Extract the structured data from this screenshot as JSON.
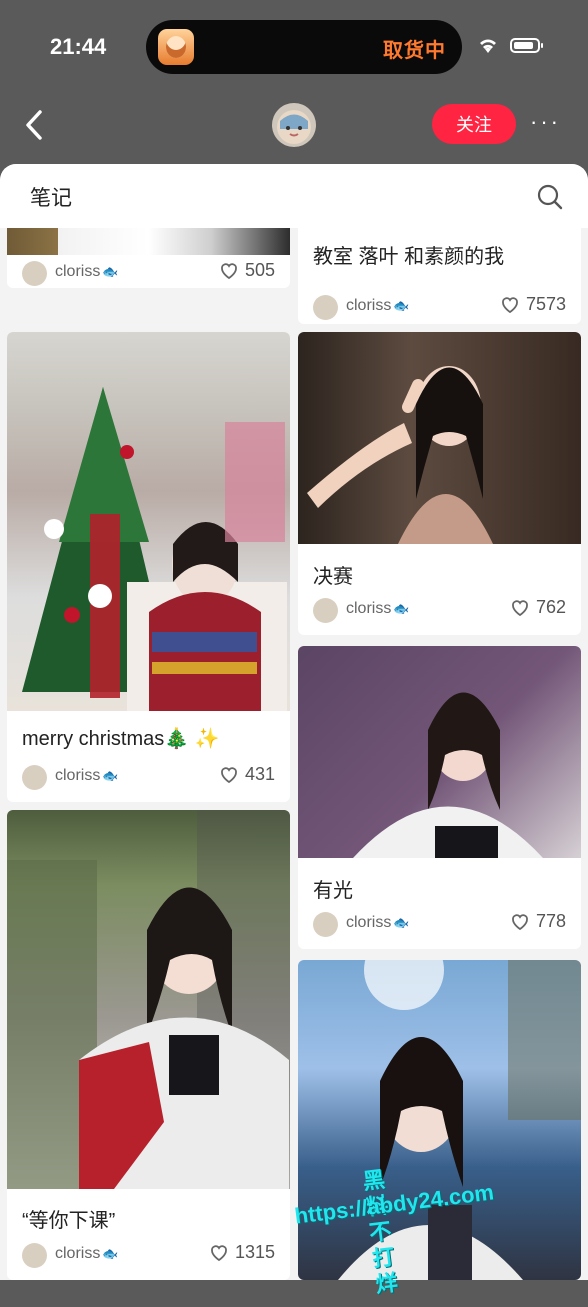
{
  "status_bar": {
    "time": "21:44",
    "live_activity_text": "取货中"
  },
  "header": {
    "follow_label": "关注",
    "more_label": "···"
  },
  "panel": {
    "title": "笔记"
  },
  "notes": [
    {
      "title": "",
      "author": "cloriss",
      "likes": "505"
    },
    {
      "title": "教室 落叶 和素颜的我",
      "author": "cloriss",
      "likes": "7573"
    },
    {
      "title": "merry christmas🎄 ✨",
      "author": "cloriss",
      "likes": "431"
    },
    {
      "title": "决赛",
      "author": "cloriss",
      "likes": "762"
    },
    {
      "title": "有光",
      "author": "cloriss",
      "likes": "778"
    },
    {
      "title": "“等你下课”",
      "author": "cloriss",
      "likes": "1315"
    },
    {
      "title": "",
      "author": "",
      "likes": ""
    }
  ],
  "watermark": {
    "line1": "黑料不打烊",
    "line2": "https://abdy24.com"
  },
  "colors": {
    "accent": "#ff2442",
    "overlay": "#5a5a5a",
    "watermark": "#22e6ee"
  },
  "icons": [
    "chevron-left-icon",
    "search-icon",
    "heart-icon",
    "wifi-icon",
    "battery-icon",
    "fish-emoji"
  ]
}
